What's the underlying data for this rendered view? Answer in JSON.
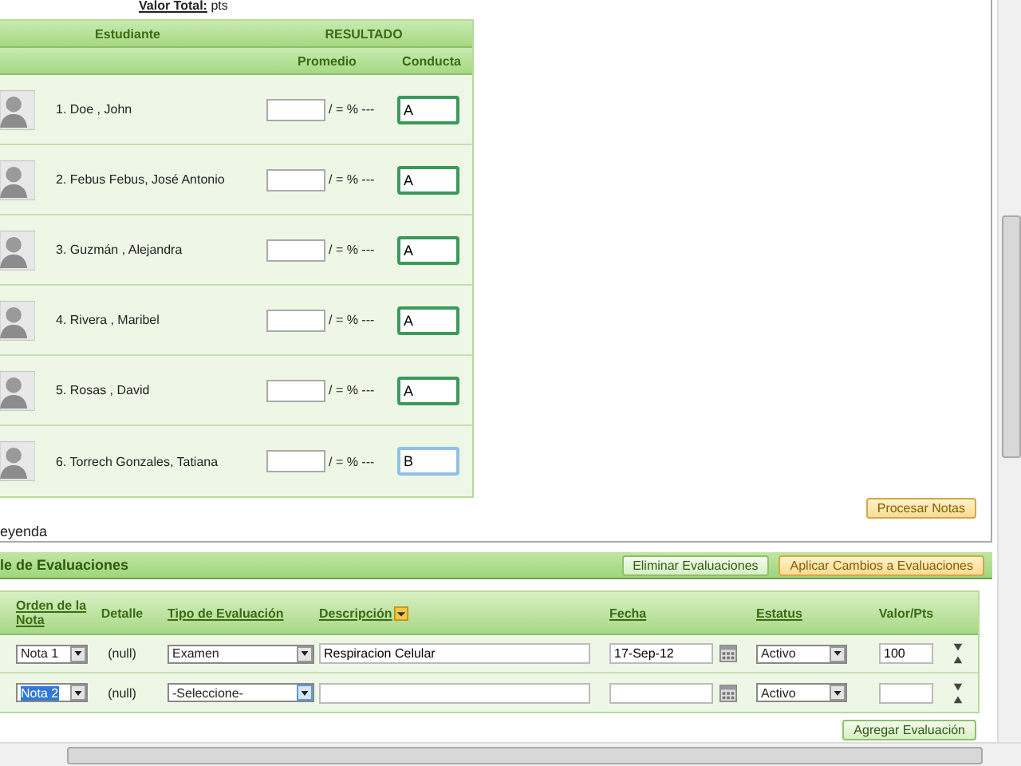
{
  "valor_total": {
    "label": "Valor Total:",
    "value": "pts"
  },
  "grades": {
    "header_student": "Estudiante",
    "header_result": "RESULTADO",
    "col_average": "Promedio",
    "col_conduct": "Conducta",
    "students": [
      {
        "name": "1. Doe , John",
        "suffix": "/ = % ---",
        "conduct": "A",
        "focused": false
      },
      {
        "name": "2. Febus Febus, José Antonio",
        "suffix": "/ = % ---",
        "conduct": "A",
        "focused": false
      },
      {
        "name": "3. Guzmán , Alejandra",
        "suffix": "/ = % ---",
        "conduct": "A",
        "focused": false
      },
      {
        "name": "4. Rivera , Maribel",
        "suffix": "/ = % ---",
        "conduct": "A",
        "focused": false
      },
      {
        "name": "5. Rosas , David",
        "suffix": "/ = % ---",
        "conduct": "A",
        "focused": false
      },
      {
        "name": "6. Torrech Gonzales, Tatiana",
        "suffix": "/ = % ---",
        "conduct": "B",
        "focused": true
      }
    ]
  },
  "process_button": "Procesar Notas",
  "legend": "eyenda",
  "evaluations": {
    "title": "le de Evaluaciones",
    "buttons": [
      {
        "label": "Eliminar Evaluaciones",
        "kind": "green"
      },
      {
        "label": "Aplicar Cambios a Evaluaciones",
        "kind": "orange"
      }
    ],
    "columns": [
      {
        "label": "Orden de la Nota",
        "link": true
      },
      {
        "label": "Detalle",
        "link": false
      },
      {
        "label": "Tipo de Evaluación",
        "link": true
      },
      {
        "label": "Descripción",
        "link": true
      },
      {
        "label": "Fecha",
        "link": true
      },
      {
        "label": "Estatus",
        "link": true
      },
      {
        "label": "Valor/Pts",
        "link": false
      }
    ],
    "rows": [
      {
        "order": {
          "value": "Nota 1",
          "focused": false
        },
        "detail": "(null)",
        "type": {
          "value": "Examen",
          "focused": false
        },
        "description": "Respiracion Celular",
        "date": "17-Sep-12",
        "status": "Activo",
        "points": "100"
      },
      {
        "order": {
          "value": "Nota 2",
          "focused": true
        },
        "detail": "(null)",
        "type": {
          "value": "-Seleccione-",
          "focused": true
        },
        "status": "Activo"
      }
    ],
    "add_button": "Agregar Evaluación"
  }
}
